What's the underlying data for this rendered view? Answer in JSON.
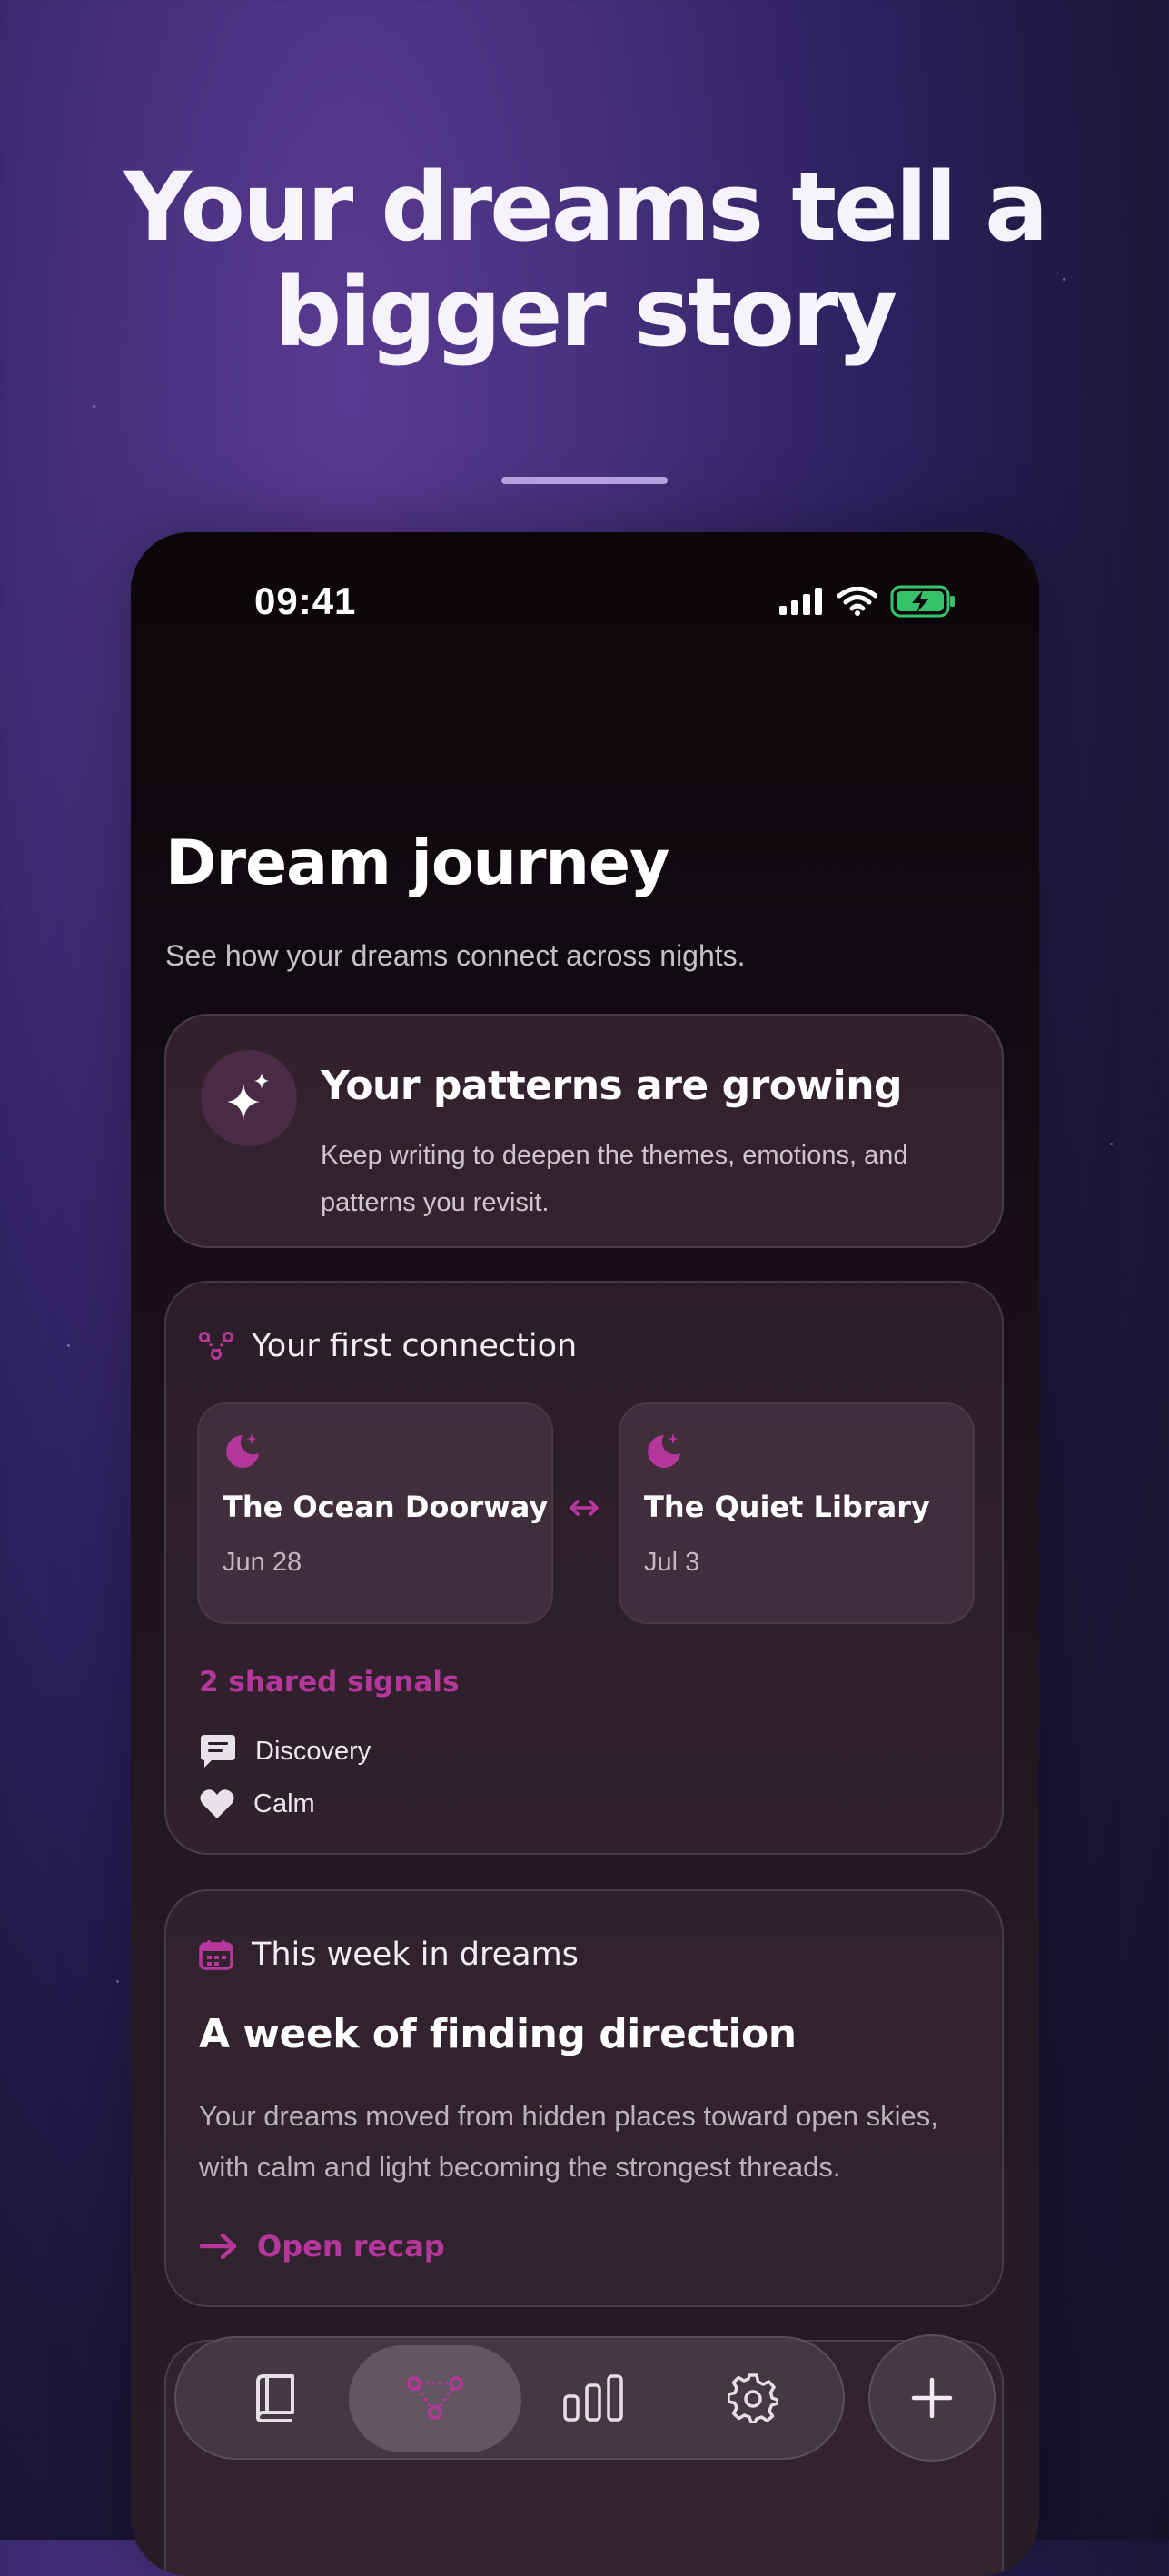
{
  "hero": {
    "title_line1": "Your dreams tell a",
    "title_line2": "bigger story"
  },
  "status_bar": {
    "time": "09:41"
  },
  "page": {
    "title": "Dream journey",
    "subtitle": "See how your dreams connect across nights."
  },
  "patterns_card": {
    "icon": "sparkle-icon",
    "title": "Your patterns are growing",
    "body": "Keep writing to deepen the themes, emotions, and patterns you revisit."
  },
  "connection_card": {
    "icon": "connection-icon",
    "title": "Your first connection",
    "dreams": [
      {
        "icon": "moon-icon",
        "title": "The Ocean Doorway",
        "date": "Jun 28"
      },
      {
        "icon": "moon-icon",
        "title": "The Quiet Library",
        "date": "Jul 3"
      }
    ],
    "shared_title": "2 shared signals",
    "signals": [
      {
        "icon": "chat-icon",
        "label": "Discovery"
      },
      {
        "icon": "heart-icon",
        "label": "Calm"
      }
    ]
  },
  "recap_card": {
    "icon": "calendar-icon",
    "label": "This week in dreams",
    "title": "A week of finding direction",
    "body": "Your dreams moved from hidden places toward open skies, with calm and light becoming the strongest threads.",
    "link": "Open recap"
  },
  "tab_bar": {
    "tabs": [
      "journal-icon",
      "connections-icon",
      "stats-icon",
      "settings-icon"
    ],
    "active_tab": "connections-icon",
    "fab": "plus-icon"
  },
  "colors": {
    "accent": "#b6379c",
    "background_top": "#5a3a92",
    "background_bottom": "#161226",
    "phone_bg": "#0b0709"
  }
}
